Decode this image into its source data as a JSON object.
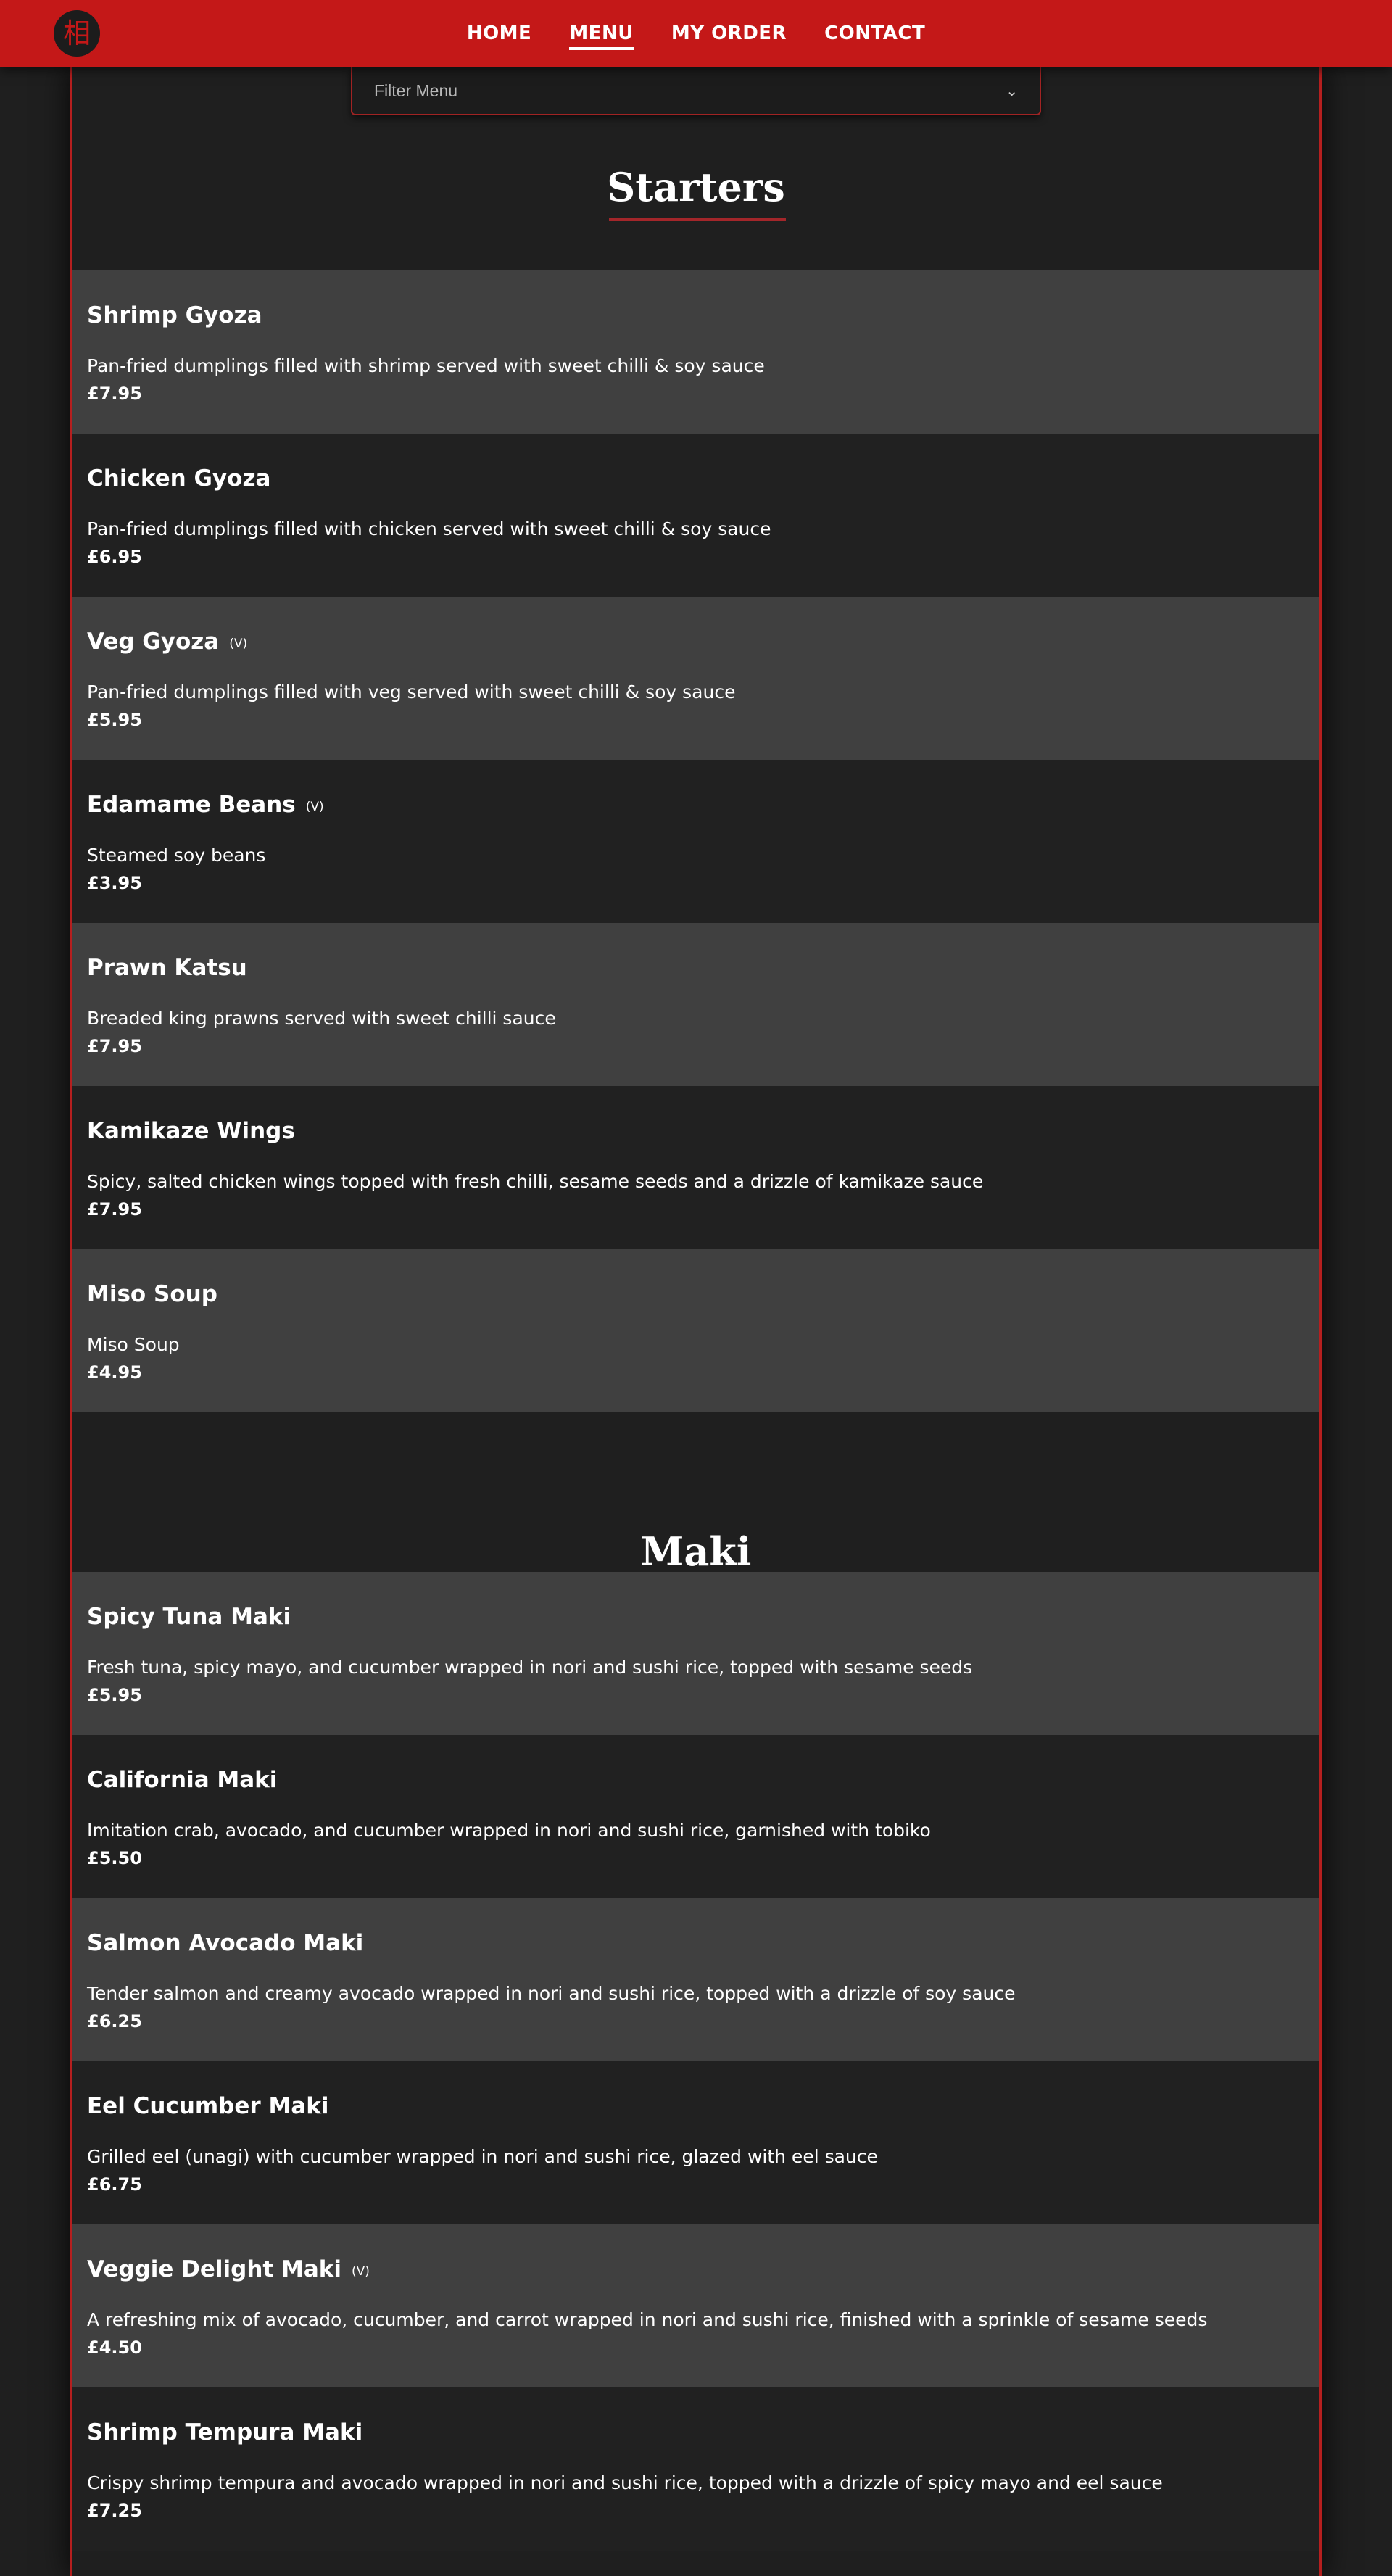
{
  "nav": {
    "logo_glyph": "相",
    "links": [
      "HOME",
      "MENU",
      "MY ORDER",
      "CONTACT"
    ],
    "active": "MENU"
  },
  "filter": {
    "placeholder": "Filter Menu"
  },
  "sections": [
    {
      "title": "Starters",
      "items": [
        {
          "name": "Shrimp Gyoza",
          "veg": "",
          "description": "Pan-fried dumplings filled with shrimp served with sweet chilli & soy sauce",
          "price": "£7.95"
        },
        {
          "name": "Chicken Gyoza",
          "veg": "",
          "description": "Pan-fried dumplings filled with chicken served with sweet chilli & soy sauce",
          "price": "£6.95"
        },
        {
          "name": "Veg Gyoza",
          "veg": "(V)",
          "description": "Pan-fried dumplings filled with veg served with sweet chilli & soy sauce",
          "price": "£5.95"
        },
        {
          "name": "Edamame Beans",
          "veg": "(V)",
          "description": "Steamed soy beans",
          "price": "£3.95"
        },
        {
          "name": "Prawn Katsu",
          "veg": "",
          "description": "Breaded king prawns served with sweet chilli sauce",
          "price": "£7.95"
        },
        {
          "name": "Kamikaze Wings",
          "veg": "",
          "description": "Spicy, salted chicken wings topped with fresh chilli, sesame seeds and a drizzle of kamikaze sauce",
          "price": "£7.95"
        },
        {
          "name": "Miso Soup",
          "veg": "",
          "description": "Miso Soup",
          "price": "£4.95"
        }
      ]
    },
    {
      "title": "Maki",
      "items": [
        {
          "name": "Spicy Tuna Maki",
          "veg": "",
          "description": "Fresh tuna, spicy mayo, and cucumber wrapped in nori and sushi rice, topped with sesame seeds",
          "price": "£5.95"
        },
        {
          "name": "California Maki",
          "veg": "",
          "description": "Imitation crab, avocado, and cucumber wrapped in nori and sushi rice, garnished with tobiko",
          "price": "£5.50"
        },
        {
          "name": "Salmon Avocado Maki",
          "veg": "",
          "description": "Tender salmon and creamy avocado wrapped in nori and sushi rice, topped with a drizzle of soy sauce",
          "price": "£6.25"
        },
        {
          "name": "Eel Cucumber Maki",
          "veg": "",
          "description": "Grilled eel (unagi) with cucumber wrapped in nori and sushi rice, glazed with eel sauce",
          "price": "£6.75"
        },
        {
          "name": "Veggie Delight Maki",
          "veg": "(V)",
          "description": "A refreshing mix of avocado, cucumber, and carrot wrapped in nori and sushi rice, finished with a sprinkle of sesame seeds",
          "price": "£4.50"
        },
        {
          "name": "Shrimp Tempura Maki",
          "veg": "",
          "description": "Crispy shrimp tempura and avocado wrapped in nori and sushi rice, topped with a drizzle of spicy mayo and eel sauce",
          "price": "£7.25"
        }
      ]
    }
  ],
  "colors": {
    "brand_red": "#c41818",
    "accent_border": "#b51f1f",
    "bg_dark": "#1f1f1f",
    "row_light": "#404040"
  }
}
